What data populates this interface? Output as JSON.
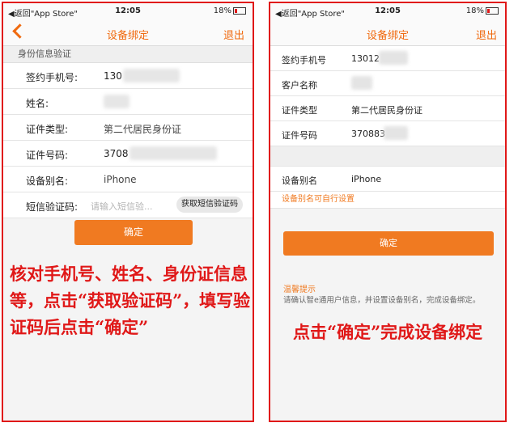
{
  "status": {
    "back_label": "◀返回\"App Store\"",
    "time": "12:05",
    "battery": "18%"
  },
  "left": {
    "nav": {
      "title": "设备绑定",
      "right": "退出"
    },
    "section": "身份信息验证",
    "rows": [
      {
        "label": "签约手机号:",
        "value": "130"
      },
      {
        "label": "姓名:",
        "value": ""
      },
      {
        "label": "证件类型:",
        "value": "第二代居民身份证"
      },
      {
        "label": "证件号码:",
        "value": "3708"
      },
      {
        "label": "设备别名:",
        "value": "iPhone"
      },
      {
        "label": "短信验证码:",
        "placeholder": "请输入短信验...",
        "button": "获取短信验证码"
      }
    ],
    "confirm": "确定",
    "caption": "核对手机号、姓名、身份证信息等，点击“获取验证码”，填写验证码后点击“确定”"
  },
  "right": {
    "nav": {
      "title": "设备绑定",
      "right": "退出"
    },
    "rows": [
      {
        "label": "签约手机号",
        "value": "13012"
      },
      {
        "label": "客户名称",
        "value": ""
      },
      {
        "label": "证件类型",
        "value": "第二代居民身份证"
      },
      {
        "label": "证件号码",
        "value": "370883"
      }
    ],
    "alias": {
      "label": "设备别名",
      "value": "iPhone",
      "note": "设备别名可自行设置"
    },
    "confirm": "确定",
    "tips_title": "温馨提示",
    "tips_body": "请确认智e通用户信息，并设置设备别名，完成设备绑定。",
    "caption": "点击“确定”完成设备绑定"
  },
  "colors": {
    "accent": "#f07a21",
    "annotation": "#e01818"
  }
}
